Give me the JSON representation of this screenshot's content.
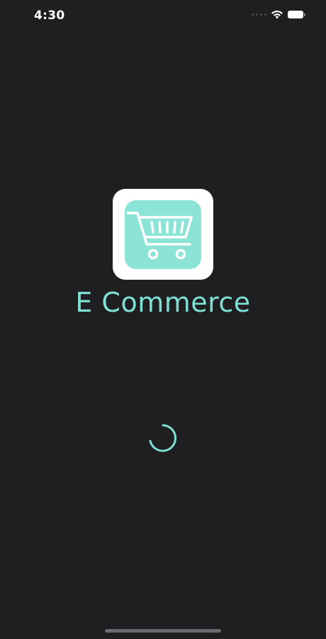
{
  "status_bar": {
    "time": "4:30",
    "icons": [
      "signal-icon",
      "wifi-icon",
      "battery-icon"
    ]
  },
  "splash": {
    "app_name": "E Commerce",
    "logo_icon": "shopping-cart-icon",
    "loading_icon": "spinner-icon"
  },
  "colors": {
    "background": "#1f1f22",
    "accent": "#7ee0d2",
    "logo_fill": "#8ce4d6",
    "logo_frame": "#ffffff"
  }
}
